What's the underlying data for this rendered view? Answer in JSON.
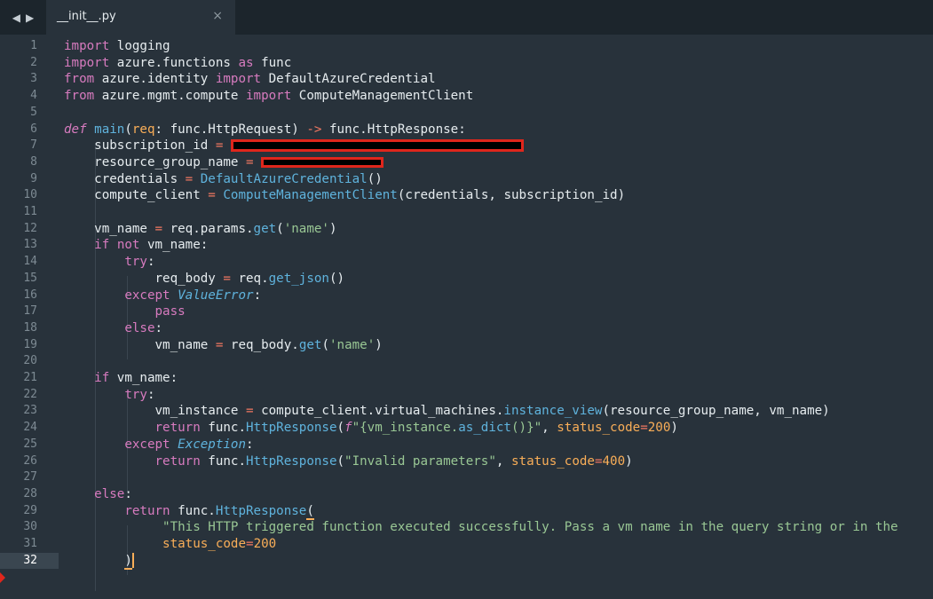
{
  "tabbar": {
    "back_arrow": "◀",
    "forward_arrow": "▶",
    "tab_title": "__init__.py",
    "close_glyph": "×"
  },
  "editor": {
    "active_line": 32,
    "line_numbers": [
      "1",
      "2",
      "3",
      "4",
      "5",
      "6",
      "7",
      "8",
      "9",
      "10",
      "11",
      "12",
      "13",
      "14",
      "15",
      "16",
      "17",
      "18",
      "19",
      "20",
      "21",
      "22",
      "23",
      "24",
      "25",
      "26",
      "27",
      "28",
      "29",
      "30",
      "31",
      "32"
    ],
    "lines": {
      "l1": [
        "import",
        " logging"
      ],
      "l2": [
        "import",
        " azure.functions ",
        "as",
        " func"
      ],
      "l3": [
        "from",
        " azure.identity ",
        "import",
        " DefaultAzureCredential"
      ],
      "l4": [
        "from",
        " azure.mgmt.compute ",
        "import",
        " ComputeManagementClient"
      ],
      "l6": [
        "def",
        " ",
        "main",
        "(",
        "req",
        ": func.HttpRequest) ",
        "->",
        " func.HttpResponse:"
      ],
      "l7": [
        "    subscription_id ",
        "=",
        " "
      ],
      "l8": [
        "    resource_group_name ",
        "=",
        " "
      ],
      "l9": [
        "    credentials ",
        "=",
        " ",
        "DefaultAzureCredential",
        "()"
      ],
      "l10": [
        "    compute_client ",
        "=",
        " ",
        "ComputeManagementClient",
        "(credentials, subscription_id)"
      ],
      "l12": [
        "    vm_name ",
        "=",
        " req.params.",
        "get",
        "(",
        "'name'",
        ")"
      ],
      "l13": [
        "    ",
        "if",
        " ",
        "not",
        " vm_name:"
      ],
      "l14": [
        "        ",
        "try",
        ":"
      ],
      "l15": [
        "            req_body ",
        "=",
        " req.",
        "get_json",
        "()"
      ],
      "l16": [
        "        ",
        "except",
        " ",
        "ValueError",
        ":"
      ],
      "l17": [
        "            ",
        "pass"
      ],
      "l18": [
        "        ",
        "else",
        ":"
      ],
      "l19": [
        "            vm_name ",
        "=",
        " req_body.",
        "get",
        "(",
        "'name'",
        ")"
      ],
      "l21": [
        "    ",
        "if",
        " vm_name:"
      ],
      "l22": [
        "        ",
        "try",
        ":"
      ],
      "l23": [
        "            vm_instance ",
        "=",
        " compute_client.virtual_machines.",
        "instance_view",
        "(resource_group_name, vm_name)"
      ],
      "l24": [
        "            ",
        "return",
        " func.",
        "HttpResponse",
        "(",
        "f",
        "\"{vm_instance.",
        "as_dict",
        "()}\"",
        ", ",
        "status_code",
        "=",
        "200",
        ")"
      ],
      "l25": [
        "        ",
        "except",
        " ",
        "Exception",
        ":"
      ],
      "l26": [
        "            ",
        "return",
        " func.",
        "HttpResponse",
        "(",
        "\"Invalid parameters\"",
        ", ",
        "status_code",
        "=",
        "400",
        ")"
      ],
      "l28": [
        "    ",
        "else",
        ":"
      ],
      "l29": [
        "        ",
        "return",
        " func.",
        "HttpResponse",
        "("
      ],
      "l30": [
        "             ",
        "\"This HTTP triggered function executed successfully. Pass a vm name in the query string or in the"
      ],
      "l31": [
        "             ",
        "status_code",
        "=",
        "200"
      ],
      "l32": [
        "        ",
        ")"
      ]
    }
  },
  "colors": {
    "background": "#28323b",
    "keyword": "#d77bbf",
    "function": "#5fb3dd",
    "string": "#99c794",
    "operator": "#f27862",
    "number": "#f9ae58",
    "redaction_border": "#e0261c"
  }
}
